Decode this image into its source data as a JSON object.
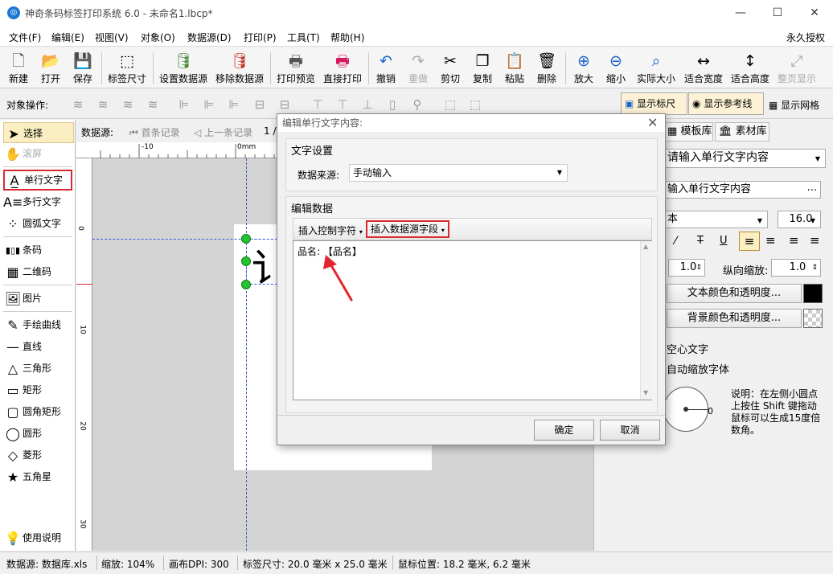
{
  "window": {
    "title": "神奇条码标签打印系统 6.0 - 未命名1.lbcp*",
    "app_icon_glyph": "◎",
    "minimize_glyph": "—",
    "maximize_glyph": "☐",
    "close_glyph": "✕"
  },
  "menu": {
    "items": [
      "文件(F)",
      "编辑(E)",
      "视图(V)",
      "对象(O)",
      "数据源(D)",
      "打印(P)",
      "工具(T)",
      "帮助(H)"
    ],
    "right_label": "永久授权"
  },
  "toolbar": {
    "buttons": [
      {
        "label": "新建",
        "icon": "🗋"
      },
      {
        "label": "打开",
        "icon": "📂"
      },
      {
        "label": "保存",
        "icon": "💾"
      },
      {
        "label": "标签尺寸",
        "icon": "⬚"
      },
      {
        "label": "设置数据源",
        "icon": "🛢"
      },
      {
        "label": "移除数据源",
        "icon": "🛢"
      },
      {
        "label": "打印预览",
        "icon": "🖶"
      },
      {
        "label": "直接打印",
        "icon": "🖶"
      },
      {
        "label": "撤销",
        "icon": "↶"
      },
      {
        "label": "重做",
        "icon": "↷"
      },
      {
        "label": "剪切",
        "icon": "✂"
      },
      {
        "label": "复制",
        "icon": "❐"
      },
      {
        "label": "粘贴",
        "icon": "📋"
      },
      {
        "label": "删除",
        "icon": "🗑"
      },
      {
        "label": "放大",
        "icon": "⊕"
      },
      {
        "label": "缩小",
        "icon": "⊖"
      },
      {
        "label": "实际大小",
        "icon": "⌕"
      },
      {
        "label": "适合宽度",
        "icon": "↔"
      },
      {
        "label": "适合高度",
        "icon": "↕"
      },
      {
        "label": "整页显示",
        "icon": "⤢"
      }
    ]
  },
  "objbar": {
    "label": "对象操作:",
    "show_ruler": "显示标尺",
    "show_guides": "显示参考线",
    "show_grid": "显示网格"
  },
  "tools": {
    "items": [
      {
        "label": "选择",
        "icon": "➤"
      },
      {
        "label": "滚屏",
        "icon": "✋"
      },
      {
        "label": "单行文字",
        "icon": "A̲"
      },
      {
        "label": "多行文字",
        "icon": "A≡"
      },
      {
        "label": "圆弧文字",
        "icon": "⁘"
      },
      {
        "label": "条码",
        "icon": "▮▯▮"
      },
      {
        "label": "二维码",
        "icon": "▦"
      },
      {
        "label": "图片",
        "icon": "🖼"
      },
      {
        "label": "手绘曲线",
        "icon": "✎"
      },
      {
        "label": "直线",
        "icon": "—"
      },
      {
        "label": "三角形",
        "icon": "△"
      },
      {
        "label": "矩形",
        "icon": "▭"
      },
      {
        "label": "圆角矩形",
        "icon": "▢"
      },
      {
        "label": "圆形",
        "icon": "◯"
      },
      {
        "label": "菱形",
        "icon": "◇"
      },
      {
        "label": "五角星",
        "icon": "★"
      }
    ],
    "help_label": "使用说明",
    "help_icon": "💡"
  },
  "nav": {
    "label": "数据源:",
    "first": "首条记录",
    "prev": "上一条记录",
    "page": "1 /"
  },
  "ruler": {
    "minus10": "-10",
    "zero": "0mm",
    "v0": "0",
    "v10": "10",
    "v20": "20",
    "v30": "30"
  },
  "canvas": {
    "partial_char": "讠"
  },
  "right_panel": {
    "tab_templates": "模板库",
    "tab_assets": "素材库",
    "text_type": "请输入单行文字内容",
    "text_content": "输入单行文字内容",
    "more": "...",
    "font_name": "本",
    "font_size": "16.0",
    "spacing_value": "1.0",
    "vscale_label": "纵向缩放:",
    "vscale_value": "1.0",
    "text_color_btn": "文本颜色和透明度...",
    "bg_color_btn": "背景颜色和透明度...",
    "hollow_text": "空心文字",
    "auto_scale": "自动缩放字体",
    "angle_value": "0",
    "note": "说明：在左侧小圆点上按住 Shift 键拖动鼠标可以生成15度倍数角。"
  },
  "status": {
    "datasource": "数据源: 数据库.xls",
    "zoom": "缩放: 104%",
    "dpi": "画布DPI: 300",
    "label_size": "标签尺寸: 20.0 毫米 x 25.0 毫米",
    "mouse_pos": "鼠标位置: 18.2 毫米, 6.2 毫米"
  },
  "dialog": {
    "title": "编辑单行文字内容:",
    "group_text_settings": "文字设置",
    "source_label": "数据来源:",
    "source_value": "手动输入",
    "group_edit_data": "编辑数据",
    "insert_control": "插入控制字符",
    "insert_field": "插入数据源字段",
    "content": "品名: 【品名】",
    "ok": "确定",
    "cancel": "取消"
  },
  "colors": {
    "highlight_red": "#d9282f",
    "toggle_bg": "#fdf2d6",
    "guide_blue": "#3b5bdb",
    "handle_green": "#22c32e"
  }
}
